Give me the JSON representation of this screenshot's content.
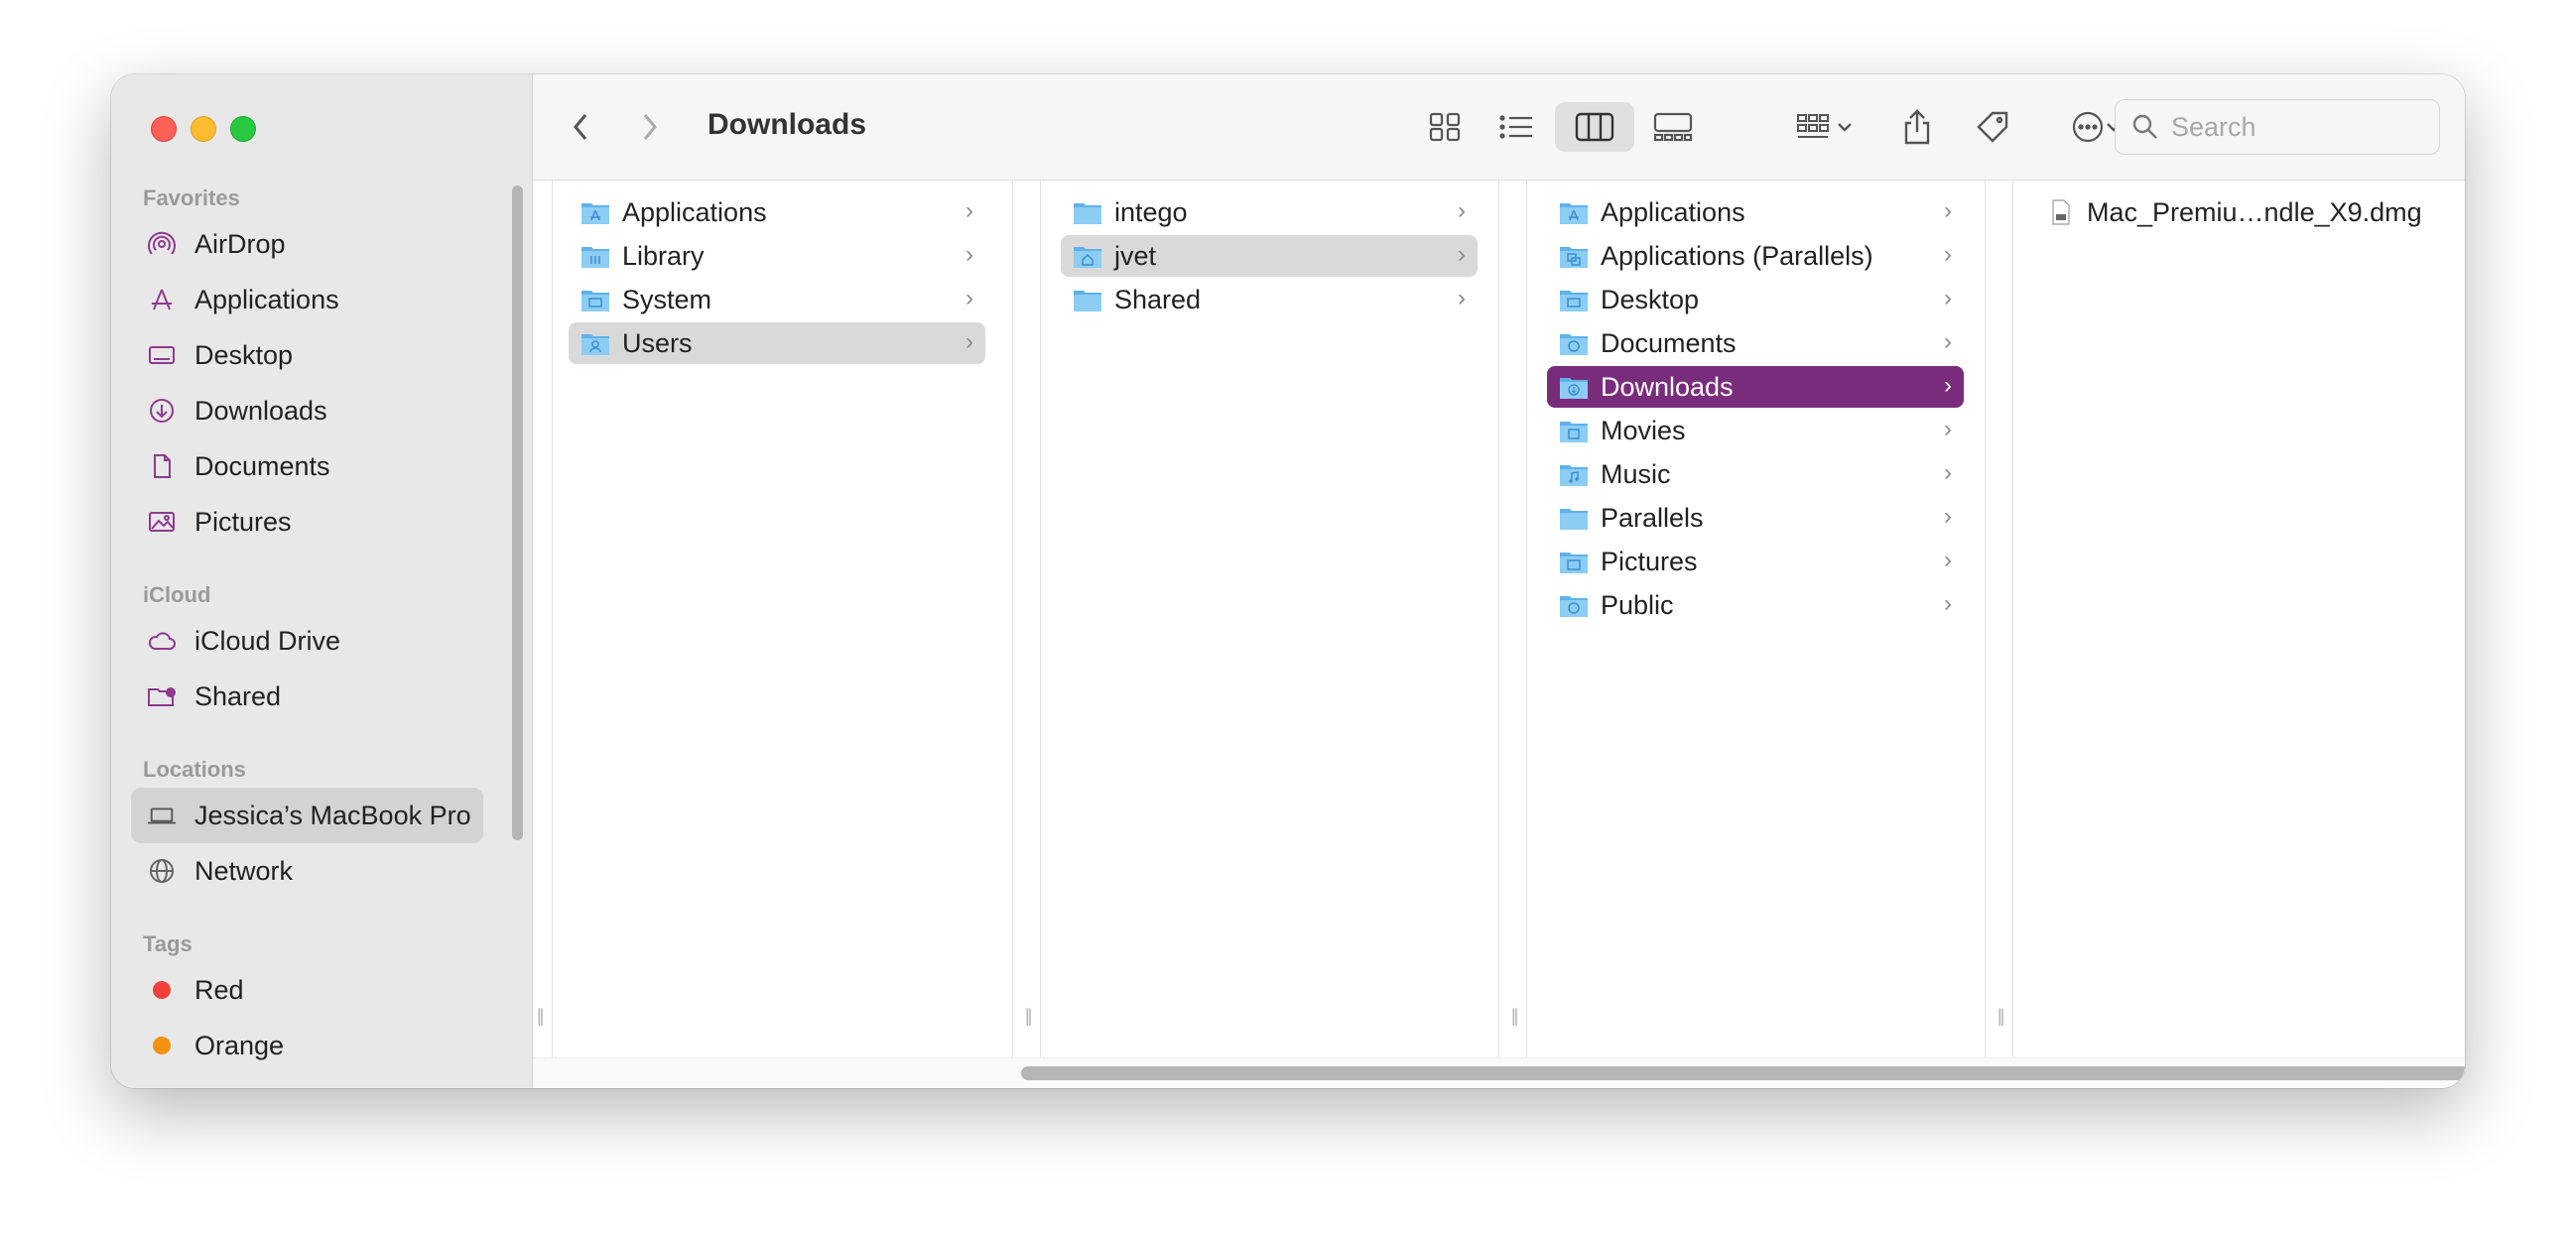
{
  "window": {
    "title": "Downloads"
  },
  "sidebar": {
    "favorites_label": "Favorites",
    "favorites": [
      {
        "label": "AirDrop",
        "icon": "airdrop-icon"
      },
      {
        "label": "Applications",
        "icon": "applications-icon"
      },
      {
        "label": "Desktop",
        "icon": "desktop-icon"
      },
      {
        "label": "Downloads",
        "icon": "downloads-icon"
      },
      {
        "label": "Documents",
        "icon": "documents-icon"
      },
      {
        "label": "Pictures",
        "icon": "pictures-icon"
      }
    ],
    "icloud_label": "iCloud",
    "icloud": [
      {
        "label": "iCloud Drive",
        "icon": "cloud-icon"
      },
      {
        "label": "Shared",
        "icon": "shared-folder-icon"
      }
    ],
    "locations_label": "Locations",
    "locations": [
      {
        "label": "Jessica’s MacBook Pro",
        "icon": "laptop-icon"
      },
      {
        "label": "Network",
        "icon": "globe-icon"
      }
    ],
    "tags_label": "Tags",
    "tags": [
      {
        "label": "Red",
        "color": "#f1413a"
      },
      {
        "label": "Orange",
        "color": "#f4920f"
      }
    ]
  },
  "toolbar": {
    "search_placeholder": "Search"
  },
  "columns": [
    {
      "items": [
        "Applications",
        "Library",
        "System",
        "Users"
      ],
      "selected": "Users"
    },
    {
      "items": [
        "intego",
        "jvet",
        "Shared"
      ],
      "selected": "jvet"
    },
    {
      "items": [
        "Applications",
        "Applications (Parallels)",
        "Desktop",
        "Documents",
        "Downloads",
        "Movies",
        "Music",
        "Parallels",
        "Pictures",
        "Public"
      ],
      "selected": "Downloads"
    },
    {
      "items": [
        "Mac_Premiu…ndle_X9.dmg"
      ]
    }
  ],
  "accent_color": "#7a2c7c"
}
